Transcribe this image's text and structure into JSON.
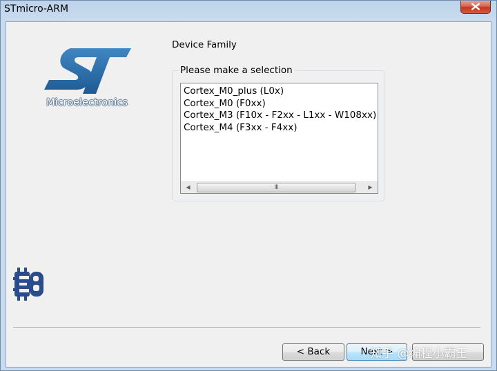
{
  "window": {
    "title": "STmicro-ARM"
  },
  "branding": {
    "st_logo_tagline": "Microelectronics",
    "st_logo_color": "#2f6fa6",
    "eb_logo_color": "#2b4c8c"
  },
  "page": {
    "section_title": "Device Family",
    "group_label": "Please make a selection"
  },
  "device_list": {
    "items": [
      "Cortex_M0_plus (L0x)",
      "Cortex_M0 (F0xx)",
      "Cortex_M3 (F10x - F2xx - L1xx - W108xx)",
      "Cortex_M4 (F3xx - F4xx)"
    ],
    "scroll_grip": "III"
  },
  "buttons": {
    "back": "< Back",
    "next": "Next >",
    "finish": ""
  },
  "watermark": {
    "text": "知乎 @编程小霸王"
  }
}
